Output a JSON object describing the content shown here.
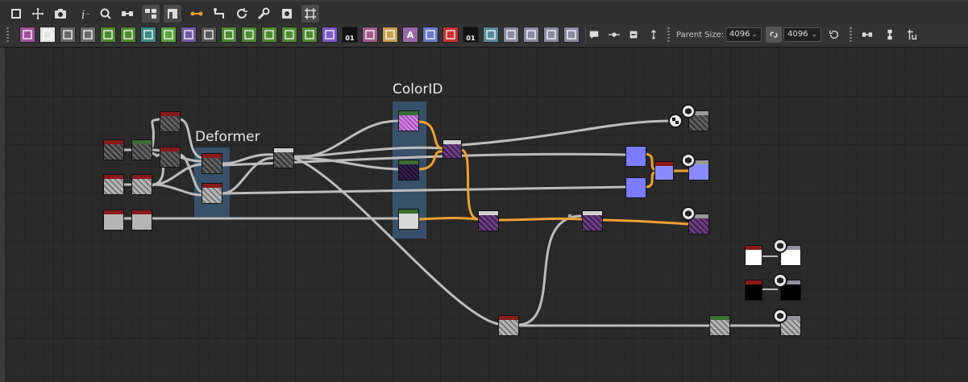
{
  "toolbar_top": {
    "icons": [
      "frame-all-icon",
      "pan-icon",
      "camera-icon",
      "info-icon",
      "zoom-icon",
      "link-node-icon",
      "graph-view-icon",
      "layout-icon",
      "connect-icon",
      "reroute-icon",
      "cycle-icon",
      "wrench-icon",
      "display-icon",
      "snap-grid-icon"
    ]
  },
  "toolbar_nodes": {
    "parent_size_label": "Parent Size:",
    "size_width": "4096",
    "size_height": "4096",
    "tiles": [
      {
        "name": "bitmap-node-icon",
        "color": "#a0509a",
        "glyph": ""
      },
      {
        "name": "svg-node-icon",
        "color": "#e6e6e6",
        "glyph": ""
      },
      {
        "name": "uniform-color-icon",
        "color": "#666666",
        "glyph": ""
      },
      {
        "name": "switch-node-icon",
        "color": "#6a6a6a",
        "glyph": ""
      },
      {
        "name": "gradient-map-icon",
        "color": "#4d8a32",
        "glyph": ""
      },
      {
        "name": "blend-node-icon",
        "color": "#4d8a32",
        "glyph": ""
      },
      {
        "name": "transform-node-icon",
        "color": "#3d8a8a",
        "glyph": ""
      },
      {
        "name": "directional-warp-icon",
        "color": "#5aa03c",
        "glyph": ""
      },
      {
        "name": "curve-node-icon",
        "color": "#6e5aa0",
        "glyph": ""
      },
      {
        "name": "tile-generator-icon",
        "color": "#555555",
        "glyph": ""
      },
      {
        "name": "levels-node-icon",
        "color": "#4d8a32",
        "glyph": ""
      },
      {
        "name": "hsl-node-icon",
        "color": "#4d8a32",
        "glyph": ""
      },
      {
        "name": "gradient-node-icon",
        "color": "#4d8a32",
        "glyph": ""
      },
      {
        "name": "grayscale-node-icon",
        "color": "#4d8a32",
        "glyph": ""
      },
      {
        "name": "histogram-node-icon",
        "color": "#4d8a32",
        "glyph": ""
      },
      {
        "name": "color-wheel-icon",
        "color": "#7a5ac8",
        "glyph": ""
      },
      {
        "name": "noise-node-icon",
        "color": "#111111",
        "glyph": "01"
      },
      {
        "name": "warp-node-icon",
        "color": "#a05a8a",
        "glyph": ""
      },
      {
        "name": "mirror-node-icon",
        "color": "#c8a050",
        "glyph": ""
      },
      {
        "name": "text-node-icon",
        "color": "#9a6aa8",
        "glyph": "A"
      },
      {
        "name": "frame-node-icon",
        "color": "#6a7ac8",
        "glyph": ""
      },
      {
        "name": "fill-node-icon",
        "color": "#c83232",
        "glyph": ""
      },
      {
        "name": "pixel-processor-icon",
        "color": "#111111",
        "glyph": "01"
      },
      {
        "name": "fx-map-icon",
        "color": "#5a8a9a",
        "glyph": ""
      },
      {
        "name": "input-node-icon",
        "color": "#8a8aa0",
        "glyph": ""
      },
      {
        "name": "output-node-icon",
        "color": "#8a8aa0",
        "glyph": ""
      },
      {
        "name": "input-value-icon",
        "color": "#8a8aa0",
        "glyph": ""
      },
      {
        "name": "output-value-icon",
        "color": "#8a8aa0",
        "glyph": ""
      }
    ],
    "tools": [
      "comment-icon",
      "dot-node-icon",
      "pin-icon",
      "insert-icon"
    ],
    "right_icons": [
      "align-horizontal-icon",
      "align-vertical-icon",
      "snap-icon"
    ]
  },
  "graph": {
    "frames": [
      {
        "id": "deformer",
        "title": "Deformer"
      },
      {
        "id": "colorid",
        "title": "ColorID"
      }
    ],
    "node_colors": {
      "header_red": "#8a1a1a",
      "header_green": "#3a6e32",
      "header_white": "#d0d0d0",
      "body_blue": "#7b7bff",
      "body_purple": "#5a3070",
      "body_pink": "#c870d8",
      "wire_gray": "#bdbdbd",
      "wire_orange": "#f0a030"
    }
  }
}
